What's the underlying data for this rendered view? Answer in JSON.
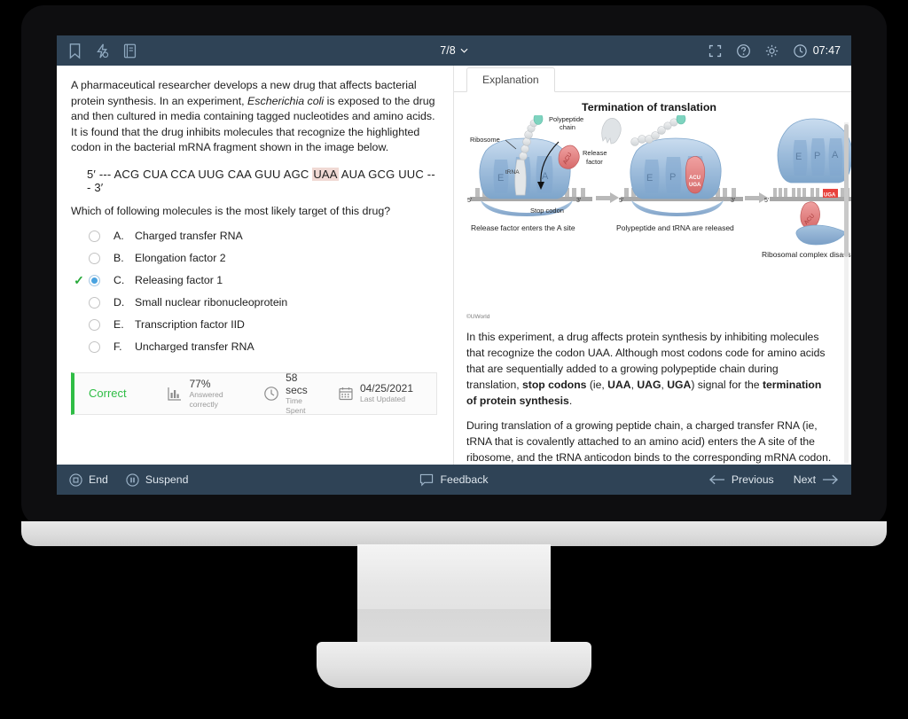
{
  "topbar": {
    "icons": [
      "bookmark-icon",
      "lab-values-icon",
      "notebook-icon"
    ],
    "question_counter": "7/8",
    "fullscreen_label": "fullscreen-icon",
    "help_label": "help-icon",
    "settings_label": "settings-icon",
    "timer": "07:47"
  },
  "question": {
    "stem_p1": "A pharmaceutical researcher develops a new drug that affects bacterial protein synthesis. In an experiment, ",
    "stem_italic": "Escherichia coli",
    "stem_p2": " is exposed to the drug and then cultured in media containing tagged nucleotides and amino acids.  It is found that the drug inhibits molecules that recognize the highlighted codon in the bacterial mRNA fragment shown in the image below.",
    "sequence_prefix": "5′ --- ACG CUA CCA UUG CAA GUU AGC ",
    "sequence_highlight": "UAA",
    "sequence_suffix": " AUA GCG UUC --- 3′",
    "lead_in": "Which of following molecules is the most likely target of this drug?",
    "choices": [
      {
        "letter": "A.",
        "text": "Charged transfer RNA",
        "selected": false,
        "correct": false
      },
      {
        "letter": "B.",
        "text": "Elongation factor 2",
        "selected": false,
        "correct": false
      },
      {
        "letter": "C.",
        "text": "Releasing factor 1",
        "selected": true,
        "correct": true
      },
      {
        "letter": "D.",
        "text": "Small nuclear ribonucleoprotein",
        "selected": false,
        "correct": false
      },
      {
        "letter": "E.",
        "text": "Transcription factor IID",
        "selected": false,
        "correct": false
      },
      {
        "letter": "F.",
        "text": "Uncharged transfer RNA",
        "selected": false,
        "correct": false
      }
    ]
  },
  "stats": {
    "result": "Correct",
    "result_color": "#2fbd45",
    "percent_value": "77%",
    "percent_label": "Answered correctly",
    "time_value": "58 secs",
    "time_label": "Time Spent",
    "updated_value": "04/25/2021",
    "updated_label": "Last Updated"
  },
  "explanation": {
    "tab_label": "Explanation",
    "figure_title": "Termination of translation",
    "copyright": "©UWorld",
    "figure_labels": {
      "ribosome": "Ribosome",
      "polypeptide_chain": "Polypeptide\nchain",
      "release_factor": "Release\nfactor",
      "trna": "tRNA",
      "stop_codon": "Stop codon",
      "codon_text": "UGA",
      "anticodon_text": "ACU",
      "sites": [
        "E",
        "P",
        "A"
      ],
      "five_prime": "5′",
      "three_prime": "3′",
      "caption_1": "Release factor enters the A site",
      "caption_2": "Polypeptide and tRNA are released",
      "caption_3": "Ribosomal complex disassembles"
    },
    "paragraph_1_a": "In this experiment, a drug affects protein synthesis by inhibiting molecules that recognize the codon UAA.  Although most codons code for amino acids that are sequentially added to a growing polypeptide chain during translation, ",
    "paragraph_1_b": "stop codons",
    "paragraph_1_c": " (ie, ",
    "paragraph_1_d": "UAA",
    "paragraph_1_e": ", ",
    "paragraph_1_f": "UAG",
    "paragraph_1_g": ", ",
    "paragraph_1_h": "UGA",
    "paragraph_1_i": ") signal for the ",
    "paragraph_1_j": "termination of protein synthesis",
    "paragraph_1_k": ".",
    "paragraph_2": "During translation of a growing peptide chain, a charged transfer RNA (ie, tRNA that is covalently attached to an amino acid) enters the A site of the ribosome, and the tRNA anticodon binds to the corresponding mRNA codon.  A peptide bond forms between the"
  },
  "bottombar": {
    "end_label": "End",
    "suspend_label": "Suspend",
    "feedback_label": "Feedback",
    "previous_label": "Previous",
    "next_label": "Next"
  },
  "colors": {
    "chrome": "#2f4356",
    "accent_green": "#2fbd45",
    "highlight": "#f0d9d4",
    "radio_selected": "#4aa3e0"
  }
}
